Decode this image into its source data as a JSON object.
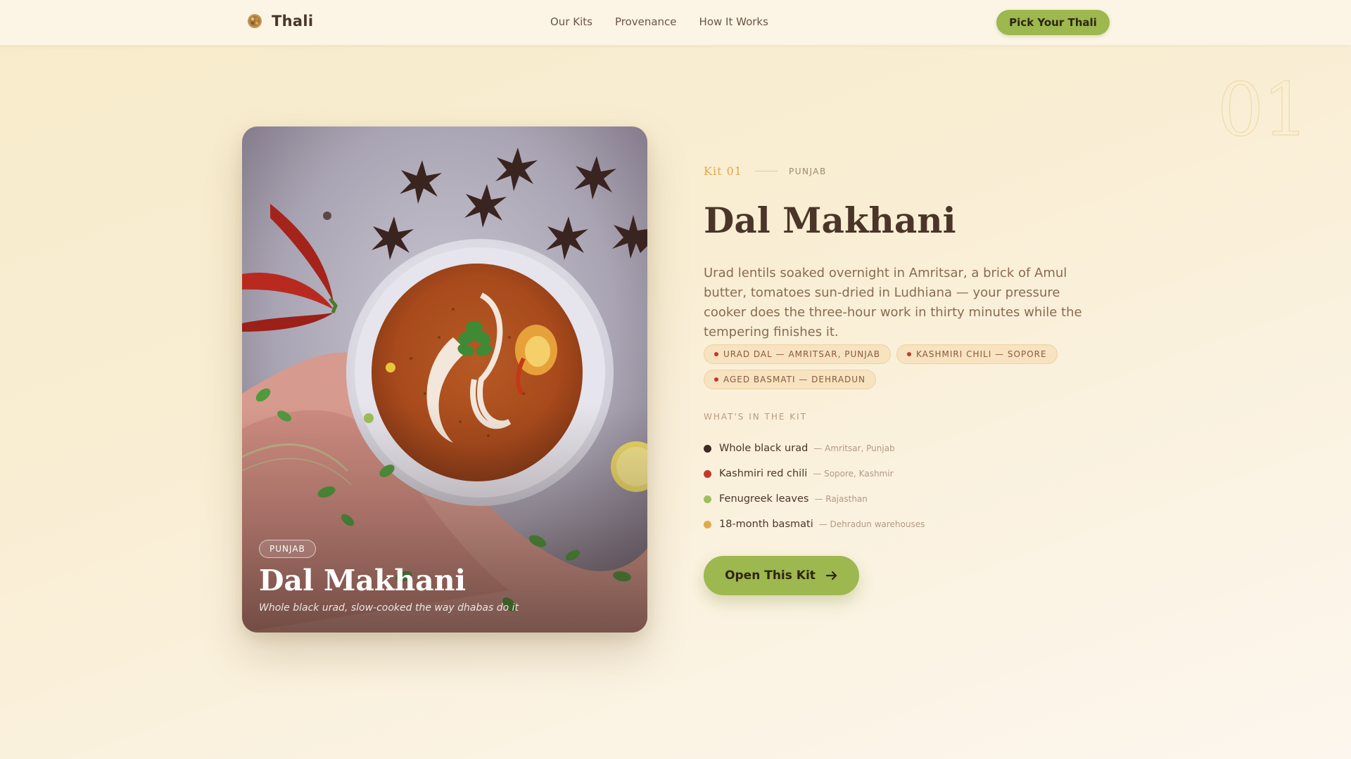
{
  "header": {
    "brand": "Thali",
    "nav": [
      "Our Kits",
      "Provenance",
      "How It Works"
    ],
    "cta_label": "Pick Your Thali"
  },
  "hero": {
    "numeral": "01",
    "card": {
      "tag": "PUNJAB",
      "title": "Dal Makhani",
      "subtitle": "Whole black urad, slow-cooked the way dhabas do it"
    },
    "kit_label": "Kit 01",
    "region": "PUNJAB",
    "title": "Dal Makhani",
    "description": "Urad lentils soaked overnight in Amritsar, a brick of Amul butter, tomatoes sun-dried in Ludhiana — your pressure cooker does the three-hour work in thirty minutes while the tempering finishes it.",
    "pills": [
      "URAD DAL — AMRITSAR, PUNJAB",
      "KASHMIRI CHILI — SOPORE",
      "AGED BASMATI — DEHRADUN"
    ],
    "kit_section_label": "WHAT'S IN THE KIT",
    "ingredients": [
      {
        "name": "Whole black urad",
        "source": "— Amritsar, Punjab",
        "color": "#3d2a22"
      },
      {
        "name": "Kashmiri red chili",
        "source": "— Sopore, Kashmir",
        "color": "#c2392b"
      },
      {
        "name": "Fenugreek leaves",
        "source": "— Rajasthan",
        "color": "#9cc05a"
      },
      {
        "name": "18-month basmati",
        "source": "— Dehradun warehouses",
        "color": "#e0a94a"
      }
    ],
    "cta_label": "Open This Kit"
  },
  "colors": {
    "accent": "#9cb84e",
    "gold": "#e0a94a",
    "brown": "#4a3528",
    "chili": "#c2392b"
  }
}
